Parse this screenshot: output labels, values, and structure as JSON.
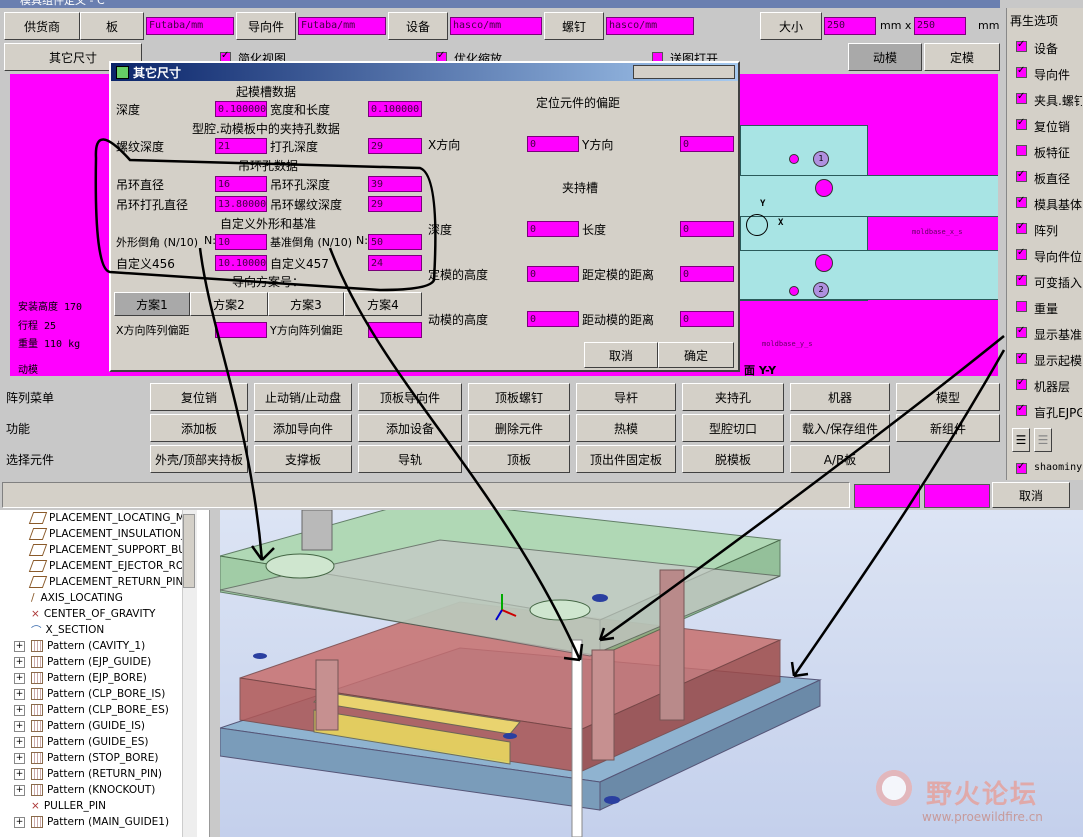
{
  "window_title": "模具组件定义 - C",
  "top_row": {
    "supplier_label": "供货商",
    "plate_label": "板",
    "plate_value": "Futaba/mm",
    "guide_label": "导向件",
    "guide_value": "Futaba/mm",
    "device_label": "设备",
    "device_value": "hasco/mm",
    "screw_label": "螺钉",
    "screw_value": "hasco/mm",
    "size_label": "大小",
    "size_w": "250",
    "size_h": "250",
    "unit1": "mm x",
    "unit2": "mm"
  },
  "second_row": {
    "other_size": "其它尺寸",
    "simplify_view": "简化视图",
    "optimize_zoom": "优化缩放",
    "send_open": "送图打开",
    "moving_mold": "动模",
    "fixed_mold": "定模"
  },
  "left_info": {
    "install_height": "安装高度 170",
    "stroke": "行程 25",
    "weight": "重量 110 kg",
    "mode": "动模"
  },
  "view_labels": {
    "y_axis": "Y",
    "x_axis": "X",
    "section": "面 Y-Y",
    "tag1": "moldbase_x_s",
    "tag2": "moldbase_y_s"
  },
  "dialog": {
    "title": "其它尺寸",
    "slot_header": "起模槽数据",
    "depth_label": "深度",
    "depth_value": "0.100000",
    "width_len_label": "宽度和长度",
    "width_len_value": "0.100000",
    "clamp_header": "型腔.动模板中的夹持孔数据",
    "thread_depth_label": "螺纹深度",
    "thread_depth_value": "21",
    "drill_depth_label": "打孔深度",
    "drill_depth_value": "29",
    "ring_header": "吊环孔数据",
    "ring_dia_label": "吊环直径",
    "ring_dia_value": "16",
    "ring_depth_label": "吊环孔深度",
    "ring_depth_value": "39",
    "ring_drill_label": "吊环打孔直径",
    "ring_drill_value": "13.80000",
    "ring_thread_label": "吊环螺纹深度",
    "ring_thread_value": "29",
    "custom_header": "自定义外形和基准",
    "outer_chamfer_label": "外形倒角 (N/10)",
    "outer_chamfer_n": "N:",
    "outer_chamfer_value": "10",
    "datum_chamfer_label": "基准倒角 (N/10)",
    "datum_chamfer_n": "N:",
    "datum_chamfer_value": "50",
    "custom456_label": "自定义456",
    "custom456_value": "10.10000",
    "custom457_label": "自定义457",
    "custom457_value": "24",
    "guide_scheme_header": "导向方案号：",
    "schemes": [
      "方案1",
      "方案2",
      "方案3",
      "方案4"
    ],
    "x_offset_label": "X方向阵列偏距",
    "x_offset_value": "",
    "y_offset_label": "Y方向阵列偏距",
    "y_offset_value": "",
    "locate_header": "定位元件的偏距",
    "x_dir_label": "X方向",
    "x_dir_value": "0",
    "y_dir_label": "Y方向",
    "y_dir_value": "0",
    "clamp_slot_header": "夹持槽",
    "slot_depth_label": "深度",
    "slot_depth_value": "0",
    "slot_len_label": "长度",
    "slot_len_value": "0",
    "fixed_height_label": "定模的高度",
    "fixed_height_value": "0",
    "fixed_dist_label": "距定模的距离",
    "fixed_dist_value": "0",
    "moving_height_label": "动模的高度",
    "moving_height_value": "0",
    "moving_dist_label": "距动模的距离",
    "moving_dist_value": "0",
    "cancel": "取消",
    "ok": "确定"
  },
  "right_panel": {
    "title": "再生选项",
    "items": [
      {
        "label": "设备",
        "checked": true
      },
      {
        "label": "导向件",
        "checked": true
      },
      {
        "label": "夹具.螺钉",
        "checked": true
      },
      {
        "label": "复位销",
        "checked": true
      },
      {
        "label": "板特征",
        "checked": false
      },
      {
        "label": "板直径",
        "checked": true
      },
      {
        "label": "模具基体",
        "checked": true
      },
      {
        "label": "阵列",
        "checked": true
      },
      {
        "label": "导向件位置",
        "checked": true
      },
      {
        "label": "可变插入",
        "checked": true
      },
      {
        "label": "重量",
        "checked": false
      },
      {
        "label": "显示基准",
        "checked": true
      },
      {
        "label": "显示起模",
        "checked": true
      },
      {
        "label": "机器层",
        "checked": true
      },
      {
        "label": "盲孔EJPG",
        "checked": true
      }
    ],
    "user": "shaominy"
  },
  "menu_rows": [
    {
      "label": "阵列菜单",
      "buttons": [
        "复位销",
        "止动销/止动盘",
        "顶板导向件",
        "顶板螺钉",
        "导杆",
        "夹持孔",
        "机器",
        "模型"
      ]
    },
    {
      "label": "功能",
      "buttons": [
        "添加板",
        "添加导向件",
        "添加设备",
        "删除元件",
        "热模",
        "型腔切口",
        "载入/保存组件",
        "新组件"
      ]
    },
    {
      "label": "选择元件",
      "buttons": [
        "外壳/顶部夹持板",
        "支撑板",
        "导轨",
        "顶板",
        "顶出件固定板",
        "脱模板",
        "A/B板"
      ]
    }
  ],
  "bottom_cancel": "取消",
  "tree": [
    {
      "label": "PLACEMENT_LOCATING_M",
      "type": "placement"
    },
    {
      "label": "PLACEMENT_INSULATION_",
      "type": "placement"
    },
    {
      "label": "PLACEMENT_SUPPORT_BUS",
      "type": "placement"
    },
    {
      "label": "PLACEMENT_EJECTOR_RO",
      "type": "placement"
    },
    {
      "label": "PLACEMENT_RETURN_PIN",
      "type": "placement"
    },
    {
      "label": "AXIS_LOCATING",
      "type": "axis"
    },
    {
      "label": "CENTER_OF_GRAVITY",
      "type": "point"
    },
    {
      "label": "X_SECTION",
      "type": "section"
    },
    {
      "label": "Pattern (CAVITY_1)",
      "type": "pattern"
    },
    {
      "label": "Pattern (EJP_GUIDE)",
      "type": "pattern"
    },
    {
      "label": "Pattern (EJP_BORE)",
      "type": "pattern"
    },
    {
      "label": "Pattern (CLP_BORE_IS)",
      "type": "pattern"
    },
    {
      "label": "Pattern (CLP_BORE_ES)",
      "type": "pattern"
    },
    {
      "label": "Pattern (GUIDE_IS)",
      "type": "pattern"
    },
    {
      "label": "Pattern (GUIDE_ES)",
      "type": "pattern"
    },
    {
      "label": "Pattern (STOP_BORE)",
      "type": "pattern"
    },
    {
      "label": "Pattern (RETURN_PIN)",
      "type": "pattern"
    },
    {
      "label": "Pattern (KNOCKOUT)",
      "type": "pattern"
    },
    {
      "label": "PULLER_PIN",
      "type": "point"
    },
    {
      "label": "Pattern (MAIN_GUIDE1)",
      "type": "pattern"
    }
  ],
  "watermark": {
    "title": "野火论坛",
    "url": "www.proewildfire.cn"
  },
  "colors": {
    "accent": "#ff00ff",
    "panel": "#d4d0c8",
    "dialog_title": "#0a246a"
  }
}
